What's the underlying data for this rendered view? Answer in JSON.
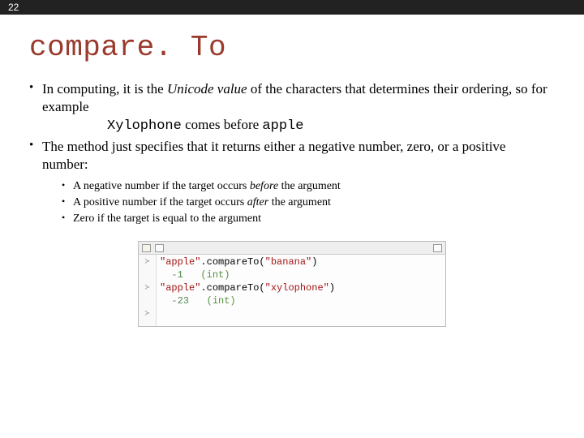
{
  "page_number": "22",
  "title": "compare. To",
  "bullets": {
    "b1_pre": "In computing, it is the ",
    "b1_ital": "Unicode value",
    "b1_post": " of the characters that determines their ordering, so for example",
    "b1_line2_pre": "Xylophone",
    "b1_line2_mid": "  comes before ",
    "b1_line2_post": "apple",
    "b2": "The method just specifies that it returns either a negative number, zero, or a positive number:",
    "sub1_pre": "A negative number if the target occurs ",
    "sub1_ital": "before",
    "sub1_post": " the argument",
    "sub2_pre": "A positive number if the target occurs ",
    "sub2_ital": "after",
    "sub2_post": " the argument",
    "sub3": "Zero if the target is equal to the argument"
  },
  "code": {
    "l1_a": "\"apple\"",
    "l1_b": ".compareTo(",
    "l1_c": "\"banana\"",
    "l1_d": ")",
    "l2_a": "-1",
    "l2_b": "   (int)",
    "l3_a": "\"apple\"",
    "l3_b": ".compareTo(",
    "l3_c": "\"xylophone\"",
    "l3_d": ")",
    "l4_a": "-23",
    "l4_b": "   (int)"
  },
  "gutter": {
    "mark": "≻"
  }
}
